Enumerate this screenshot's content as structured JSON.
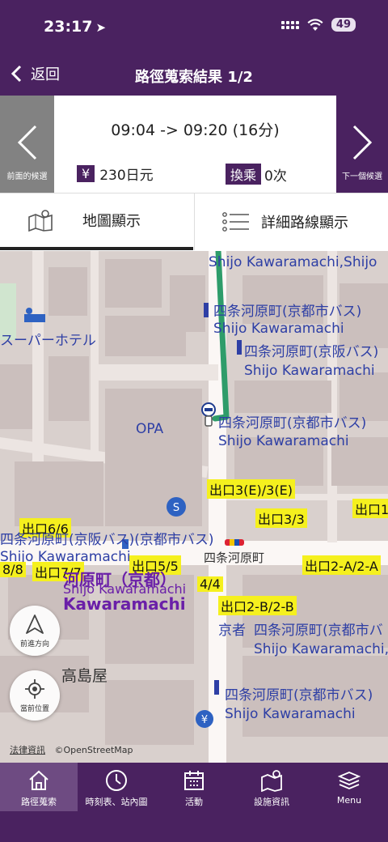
{
  "status_bar": {
    "time": "23:17",
    "battery": "49"
  },
  "header": {
    "back_label": "返回",
    "title": "路徑蒐索結果 1/2"
  },
  "summary": {
    "prev_label": "前面的候選",
    "next_label": "下一個候選",
    "time_range": "09:04 -> 09:20 (16分)",
    "fare_chip": "¥",
    "fare": "230日元",
    "transfer_chip": "換乘",
    "transfer_count": "0次"
  },
  "tabs": {
    "map": "地圖顯示",
    "detail": "詳細路線顯示"
  },
  "map": {
    "labels": {
      "shijo_kawaramachi_shijo": "Shijo Kawaramachi,Shijo",
      "bus_kyoto_1": "四条河原町(京都市バス)",
      "shijo_kawaramachi_1": "Shijo Kawaramachi",
      "hankyu_bus": "四条河原町(京阪バス)",
      "shijo_kawaramachi_2": "Shijo Kawaramachi",
      "hotel": "スーパーホテル",
      "bus_kyoto_2": "四条河原町(京都市バス)",
      "shijo_kawaramachi_3": "Shijo Kawaramachi",
      "opa": "OPA",
      "exit_3e": "出口3(E)/3(E)",
      "exit_33": "出口3/3",
      "exit_1": "出口1",
      "exit_6": "出口6/6",
      "bus_combo": "四条河原町(京阪バス)(京都市バス)",
      "shijo_kawaramachi_4": "Shijo Kawaramachi",
      "exit_7": "出口7/7",
      "exit_55": "出口5/5",
      "exit_8": "8/8",
      "station_name": "四条河原町",
      "exit_2a": "出口2-A/2-A",
      "big_jp": "河原町（京都）",
      "kawaramachi_small": "Shijo Kawaramachi",
      "kawaramachi_big": "Kawaramachi",
      "exit_44": "4/4",
      "exit_2b": "出口2-B/2-B",
      "kyoto_bus_3": "四条河原町(京都市バ",
      "kyoto_prefix": "京者",
      "shijo_kawaramachi_5": "Shijo Kawaramachi,",
      "takashimaya": "高島屋",
      "bus_kyoto_4": "四条河原町(京都市バス)",
      "shijo_kawaramachi_6": "Shijo Kawaramachi",
      "shijo_kawaramachi_top": "Shijo Kawaramachi"
    },
    "direction_button": "前進方向",
    "location_button": "當前位置",
    "legal": "法律資訊",
    "copyright": "©OpenStreetMap"
  },
  "bottom_nav": [
    {
      "label": "路徑蒐索",
      "icon": "home-icon",
      "active": true
    },
    {
      "label": "時刻表、站內圖",
      "icon": "clock-icon",
      "active": false
    },
    {
      "label": "活動",
      "icon": "calendar-icon",
      "active": false
    },
    {
      "label": "設施資訊",
      "icon": "map-icon",
      "active": false
    },
    {
      "label": "Menu",
      "icon": "layers-icon",
      "active": false
    }
  ],
  "colors": {
    "brand": "#4a2260",
    "route": "#2e9c6a",
    "label_blue": "#2e3fa5",
    "exit_yellow": "#f5f01e"
  }
}
